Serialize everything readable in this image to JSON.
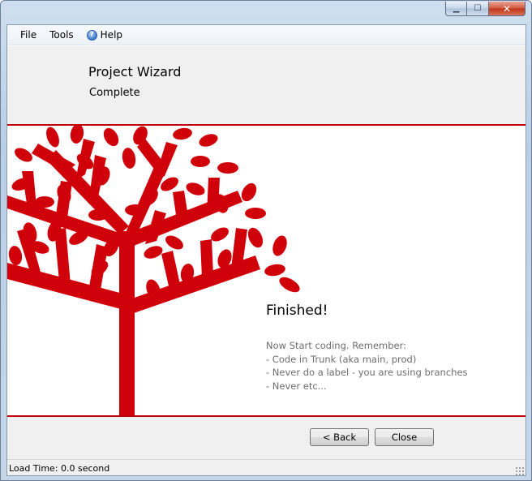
{
  "window": {
    "minimize_icon": "minimize-icon",
    "maximize_icon": "maximize-icon",
    "close_icon": "close-icon"
  },
  "menu": {
    "file": "File",
    "tools": "Tools",
    "help": "Help",
    "help_icon": "help-icon"
  },
  "header": {
    "title": "Project Wizard",
    "subtitle": "Complete"
  },
  "content": {
    "heading": "Finished!",
    "lines": [
      "Now Start coding. Remember:",
      "- Code in Trunk (aka main, prod)",
      "- Never do a label - you are using branches",
      "- Never etc..."
    ]
  },
  "buttons": {
    "back": "< Back",
    "close": "Close"
  },
  "status": {
    "load_time": "Load Time: 0.0 second"
  },
  "colors": {
    "accent_red": "#d0000a"
  }
}
